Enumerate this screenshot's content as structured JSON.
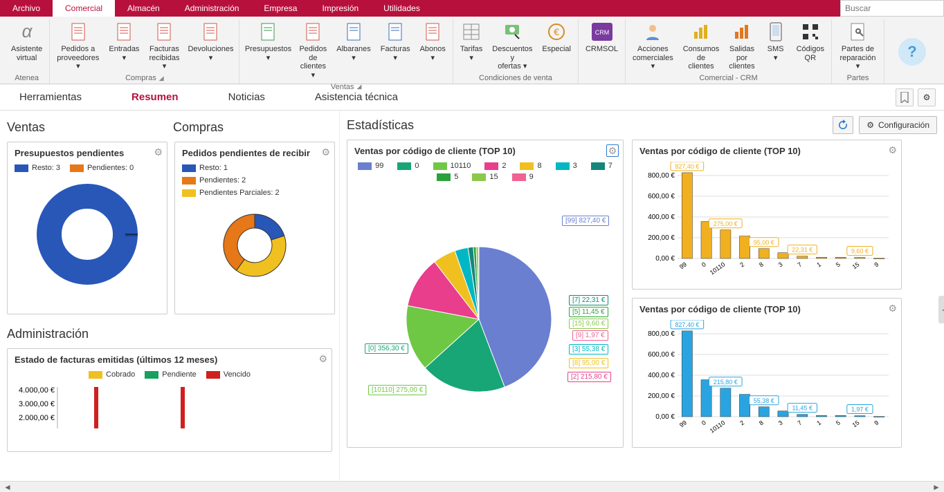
{
  "menubar": {
    "tabs": [
      "Archivo",
      "Comercial",
      "Almacén",
      "Administración",
      "Empresa",
      "Impresión",
      "Utilidades"
    ],
    "active": "Comercial",
    "search_placeholder": "Buscar"
  },
  "ribbon": {
    "groups": [
      {
        "label": "Atenea",
        "items": [
          {
            "label": "Asistente virtual",
            "icon": "alpha"
          }
        ],
        "launcher": false
      },
      {
        "label": "Compras",
        "items": [
          {
            "label": "Pedidos a proveedores ▾",
            "icon": "doc-red"
          },
          {
            "label": "Entradas ▾",
            "icon": "doc-red"
          },
          {
            "label": "Facturas recibidas ▾",
            "icon": "doc-red"
          },
          {
            "label": "Devoluciones ▾",
            "icon": "doc-red"
          }
        ],
        "launcher": true
      },
      {
        "label": "Ventas",
        "items": [
          {
            "label": "Presupuestos ▾",
            "icon": "doc-green"
          },
          {
            "label": "Pedidos de clientes ▾",
            "icon": "doc-red"
          },
          {
            "label": "Albaranes ▾",
            "icon": "doc-blue"
          },
          {
            "label": "Facturas ▾",
            "icon": "doc-blue"
          },
          {
            "label": "Abonos ▾",
            "icon": "doc-red"
          }
        ],
        "launcher": true
      },
      {
        "label": "Condiciones de venta",
        "items": [
          {
            "label": "Tarifas ▾",
            "icon": "grid"
          },
          {
            "label": "Descuentos y ofertas ▾",
            "icon": "discount"
          },
          {
            "label": "Especial",
            "icon": "euro"
          }
        ],
        "launcher": false
      },
      {
        "label": "",
        "items": [
          {
            "label": "CRMSOL",
            "icon": "crm"
          }
        ],
        "launcher": false
      },
      {
        "label": "Comercial - CRM",
        "items": [
          {
            "label": "Acciones comerciales ▾",
            "icon": "person"
          },
          {
            "label": "Consumos de clientes",
            "icon": "bars-yellow"
          },
          {
            "label": "Salidas por clientes",
            "icon": "bars-orange"
          },
          {
            "label": "SMS ▾",
            "icon": "phone"
          },
          {
            "label": "Códigos QR",
            "icon": "qr"
          }
        ],
        "launcher": false
      },
      {
        "label": "Partes",
        "items": [
          {
            "label": "Partes de reparación ▾",
            "icon": "doc-wrench"
          }
        ],
        "launcher": false
      }
    ]
  },
  "subtabs": {
    "items": [
      "Herramientas",
      "Resumen",
      "Noticias",
      "Asistencia técnica"
    ],
    "active": "Resumen"
  },
  "left": {
    "ventas_title": "Ventas",
    "compras_title": "Compras",
    "admin_title": "Administración",
    "card_presupuestos": {
      "title": "Presupuestos pendientes",
      "legend": [
        {
          "label": "Resto: 3",
          "color": "#2857b8"
        },
        {
          "label": "Pendientes: 0",
          "color": "#e67817"
        }
      ],
      "chart_type": "donut",
      "data": [
        {
          "label": "Resto",
          "value": 3,
          "color": "#2857b8"
        },
        {
          "label": "Pendientes",
          "value": 0,
          "color": "#e67817"
        }
      ]
    },
    "card_pedidos": {
      "title": "Pedidos pendientes de recibir",
      "legend": [
        {
          "label": "Resto: 1",
          "color": "#2857b8"
        },
        {
          "label": "Pendientes: 2",
          "color": "#e67817"
        },
        {
          "label": "Pendientes Parciales: 2",
          "color": "#f0c020"
        }
      ],
      "chart_type": "donut",
      "data": [
        {
          "label": "Resto",
          "value": 1,
          "color": "#2857b8"
        },
        {
          "label": "Pendientes",
          "value": 2,
          "color": "#e67817"
        },
        {
          "label": "Pendientes Parciales",
          "value": 2,
          "color": "#f0c020"
        }
      ]
    },
    "card_facturas": {
      "title": "Estado de facturas emitidas (últimos 12 meses)",
      "legend": [
        {
          "label": "Cobrado",
          "color": "#f0c020"
        },
        {
          "label": "Pendiente",
          "color": "#18a060"
        },
        {
          "label": "Vencido",
          "color": "#d01f1f"
        }
      ],
      "chart_type": "bar",
      "y_axis": [
        "4.000,00 €",
        "3.000,00 €",
        "2.000,00 €"
      ]
    }
  },
  "stats": {
    "title": "Estadísticas",
    "cfg_label": "Configuración",
    "pie": {
      "title": "Ventas por código de cliente (TOP 10)",
      "legend": [
        {
          "label": "99",
          "color": "#6a7fd0"
        },
        {
          "label": "0",
          "color": "#18a676"
        },
        {
          "label": "10110",
          "color": "#6ec843"
        },
        {
          "label": "2",
          "color": "#e83e8c"
        },
        {
          "label": "8",
          "color": "#f0c020"
        },
        {
          "label": "3",
          "color": "#00b7c3"
        },
        {
          "label": "7",
          "color": "#14877a"
        },
        {
          "label": "5",
          "color": "#2aa23a"
        },
        {
          "label": "15",
          "color": "#8cc84b"
        },
        {
          "label": "9",
          "color": "#f06292"
        }
      ],
      "callouts": [
        {
          "text": "[99] 827,40 €",
          "color": "#6a7fd0"
        },
        {
          "text": "[7] 22,31 €",
          "color": "#14877a"
        },
        {
          "text": "[5] 11,45 €",
          "color": "#2aa23a"
        },
        {
          "text": "[15] 9,60 €",
          "color": "#8cc84b"
        },
        {
          "text": "[9] 1,97 €",
          "color": "#f06292"
        },
        {
          "text": "[3] 55,38 €",
          "color": "#00b7c3"
        },
        {
          "text": "[8] 95,00 €",
          "color": "#f0c020"
        },
        {
          "text": "[2] 215,80 €",
          "color": "#e83e8c"
        },
        {
          "text": "[10110] 275,00 €",
          "color": "#6ec843"
        },
        {
          "text": "[0] 356,30 €",
          "color": "#18a676"
        }
      ]
    },
    "bar1": {
      "title": "Ventas por código de cliente (TOP 10)",
      "color": "#f0b020"
    },
    "bar2": {
      "title": "Ventas por código de cliente (TOP 10)",
      "color": "#2aa4e0"
    }
  },
  "chart_data": [
    {
      "id": "presupuestos_pendientes",
      "type": "pie",
      "title": "Presupuestos pendientes",
      "series": [
        {
          "name": "Resto",
          "value": 3
        },
        {
          "name": "Pendientes",
          "value": 0
        }
      ]
    },
    {
      "id": "pedidos_pendientes",
      "type": "pie",
      "title": "Pedidos pendientes de recibir",
      "series": [
        {
          "name": "Resto",
          "value": 1
        },
        {
          "name": "Pendientes",
          "value": 2
        },
        {
          "name": "Pendientes Parciales",
          "value": 2
        }
      ]
    },
    {
      "id": "facturas_emitidas",
      "type": "bar",
      "title": "Estado de facturas emitidas (últimos 12 meses)",
      "ylabel": "€",
      "ylim": [
        0,
        4000
      ],
      "series": [
        {
          "name": "Cobrado"
        },
        {
          "name": "Pendiente"
        },
        {
          "name": "Vencido"
        }
      ]
    },
    {
      "id": "ventas_top10_pie",
      "type": "pie",
      "title": "Ventas por código de cliente (TOP 10)",
      "series": [
        {
          "name": "99",
          "value": 827.4
        },
        {
          "name": "0",
          "value": 356.3
        },
        {
          "name": "10110",
          "value": 275.0
        },
        {
          "name": "2",
          "value": 215.8
        },
        {
          "name": "8",
          "value": 95.0
        },
        {
          "name": "3",
          "value": 55.38
        },
        {
          "name": "7",
          "value": 22.31
        },
        {
          "name": "5",
          "value": 11.45
        },
        {
          "name": "15",
          "value": 9.6
        },
        {
          "name": "9",
          "value": 1.97
        }
      ]
    },
    {
      "id": "ventas_top10_bar_A",
      "type": "bar",
      "title": "Ventas por código de cliente (TOP 10)",
      "categories": [
        "99",
        "0",
        "10110",
        "2",
        "8",
        "3",
        "7",
        "1",
        "5",
        "15",
        "9"
      ],
      "values": [
        827.4,
        356.3,
        275.0,
        215.8,
        95.0,
        55.38,
        22.31,
        11.45,
        11.45,
        9.6,
        1.97
      ],
      "value_labels": [
        "827,40 €",
        "",
        "275,00 €",
        "",
        "95,00 €",
        "",
        "22,31 €",
        "",
        "",
        "9,60 €",
        ""
      ],
      "ylim": [
        0,
        800
      ],
      "y_ticks": [
        0,
        200,
        400,
        600,
        800
      ],
      "y_tick_labels": [
        "0,00 €",
        "200,00 €",
        "400,00 €",
        "600,00 €",
        "800,00 €"
      ]
    },
    {
      "id": "ventas_top10_bar_B",
      "type": "bar",
      "title": "Ventas por código de cliente (TOP 10)",
      "categories": [
        "99",
        "0",
        "10110",
        "2",
        "8",
        "3",
        "7",
        "1",
        "5",
        "15",
        "9"
      ],
      "values": [
        827.4,
        356.3,
        275.0,
        215.8,
        95.0,
        55.38,
        22.31,
        11.45,
        11.45,
        9.6,
        1.97
      ],
      "value_labels": [
        "827,40 €",
        "",
        "215,80 €",
        "",
        "55,38 €",
        "",
        "11,45 €",
        "",
        "",
        "1,97 €",
        ""
      ],
      "ylim": [
        0,
        800
      ],
      "y_ticks": [
        0,
        200,
        400,
        600,
        800
      ],
      "y_tick_labels": [
        "0,00 €",
        "200,00 €",
        "400,00 €",
        "600,00 €",
        "800,00 €"
      ]
    }
  ]
}
